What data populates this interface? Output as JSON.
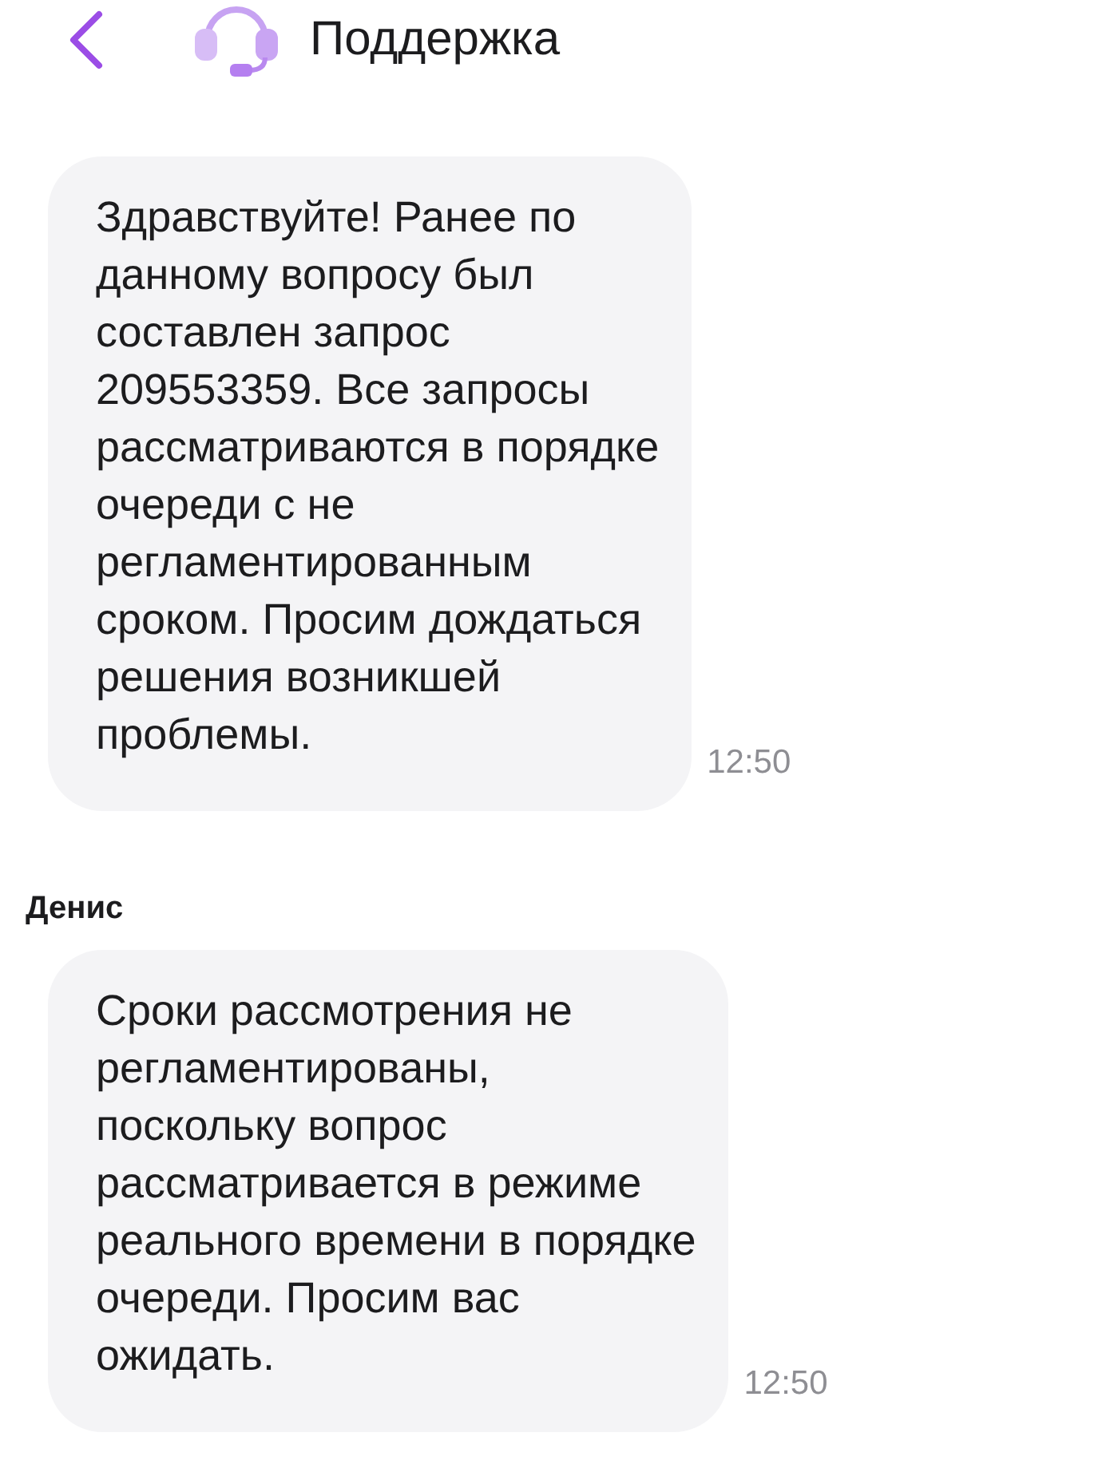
{
  "header": {
    "title": "Поддержка"
  },
  "messages": [
    {
      "text": "Здравствуйте! Ранее по\nданному вопросу был\nсоставлен запрос\n209553359. Все запросы\nрассматриваются в порядке\nочереди с не\nрегламентированным\nсроком. Просим дождаться\nрешения возникшей\nпроблемы.",
      "time": "12:50"
    },
    {
      "sender": "Денис",
      "text": "Сроки рассмотрения не\nрегламентированы,\nпоскольку вопрос\nрассматривается в режиме\nреального времени в порядке\nочереди. Просим вас\nожидать.",
      "time": "12:50"
    }
  ]
}
